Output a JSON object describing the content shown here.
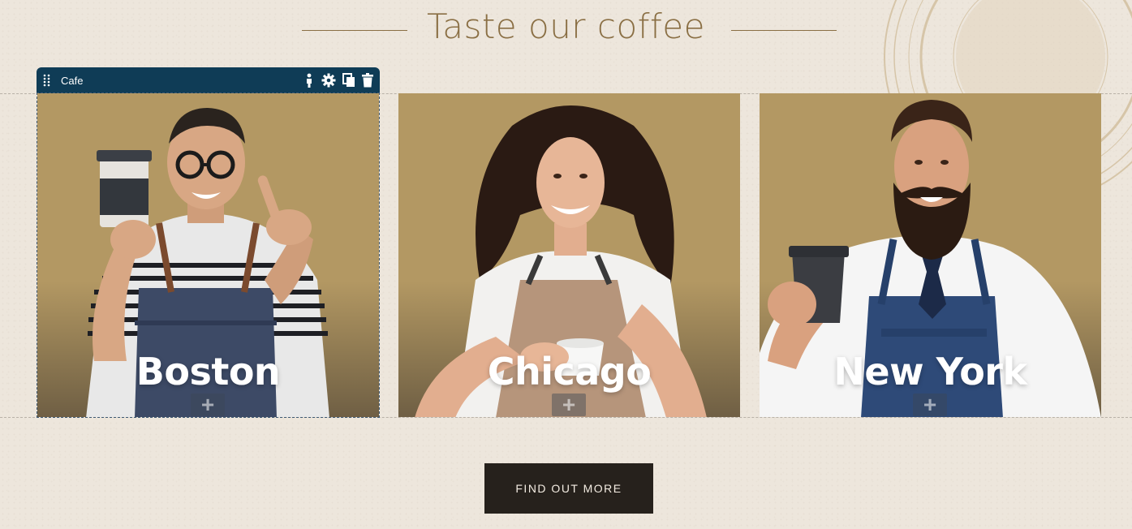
{
  "section": {
    "title": "Taste our coffee"
  },
  "editor_toolbar": {
    "label": "Cafe",
    "icons": [
      "drag-handle-icon",
      "person-icon",
      "gear-icon",
      "copy-icon",
      "trash-icon"
    ]
  },
  "cards": [
    {
      "city": "Boston",
      "add_symbol": "+"
    },
    {
      "city": "Chicago",
      "add_symbol": "+"
    },
    {
      "city": "New York",
      "add_symbol": "+"
    }
  ],
  "cta": {
    "label": "FIND OUT MORE"
  },
  "colors": {
    "accent": "#8a6f44",
    "toolbar": "#0f3c56",
    "card_bg": "#b39863",
    "button_bg": "#26211c",
    "page_bg": "#ede6dc"
  }
}
